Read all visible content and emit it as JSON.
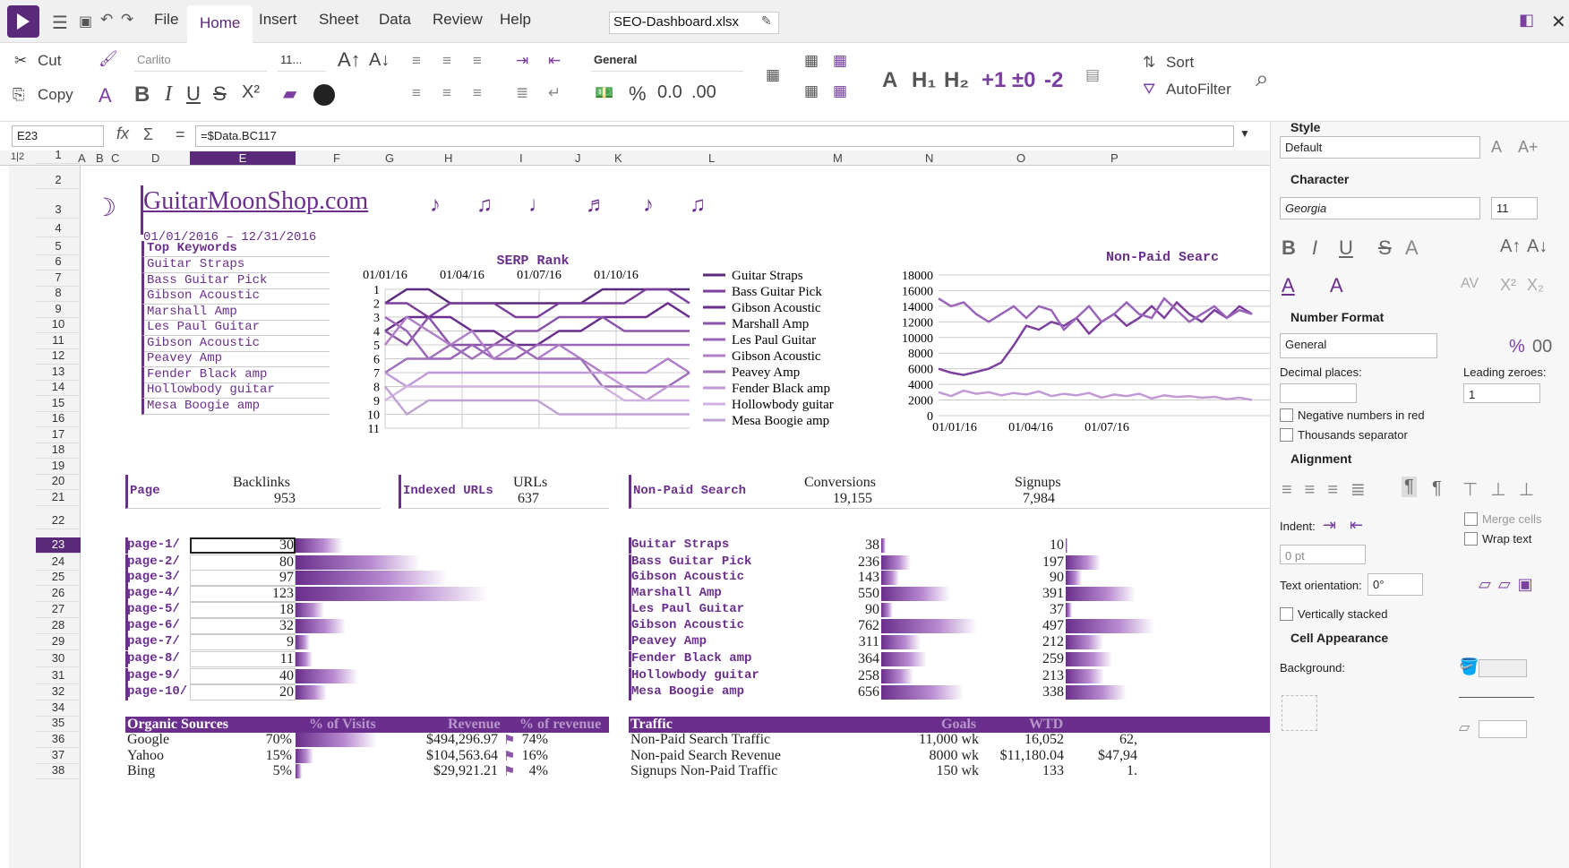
{
  "menubar": {
    "items": [
      "File",
      "Home",
      "Insert",
      "Sheet",
      "Data",
      "Review",
      "Help"
    ],
    "filename": "SEO-Dashboard.xlsx"
  },
  "toolbar": {
    "cut": "Cut",
    "copy": "Copy",
    "font": "Carlito",
    "size": "11...",
    "format": "General",
    "sort": "Sort",
    "autofilter": "AutoFilter",
    "pct": "%",
    "dec1": "0.0",
    "dec2": ".00",
    "plus1": "+1",
    "pm0": "±0",
    "minus2": "-2"
  },
  "formula": {
    "cell": "E23",
    "content": "=$Data.BC117"
  },
  "columns": [
    "A",
    "B",
    "C",
    "D",
    "E",
    "F",
    "G",
    "H",
    "I",
    "J",
    "K",
    "L",
    "M",
    "N",
    "O",
    "P"
  ],
  "rows": [
    "1",
    "2",
    "3",
    "4",
    "5",
    "6",
    "7",
    "8",
    "9",
    "10",
    "11",
    "12",
    "13",
    "14",
    "15",
    "16",
    "17",
    "18",
    "19",
    "20",
    "21",
    "22",
    "23",
    "24",
    "25",
    "26",
    "27",
    "28",
    "29",
    "30",
    "31",
    "32",
    "34",
    "35",
    "36",
    "37",
    "38"
  ],
  "dashboard": {
    "title": "GuitarMoonShop.com",
    "daterange": "01/01/2016 – 12/31/2016",
    "kw_header": "Top Keywords",
    "keywords": [
      "Guitar Straps",
      "Bass Guitar Pick",
      "Gibson Acoustic",
      "Marshall Amp",
      "Les Paul Guitar",
      "Gibson Acoustic",
      "Peavey Amp",
      "Fender Black amp",
      "Hollowbody guitar",
      "Mesa Boogie amp"
    ],
    "kpi": {
      "page": "Page",
      "backlinks_label": "Backlinks",
      "backlinks": "953",
      "indexed": "Indexed URLs",
      "urls_label": "URLs",
      "urls": "637",
      "nps": "Non-Paid Search",
      "conv_label": "Conversions",
      "conv": "19,155",
      "signups_label": "Signups",
      "signups": "7,984"
    },
    "pages": [
      {
        "p": "page-1/",
        "v": 30
      },
      {
        "p": "page-2/",
        "v": 80
      },
      {
        "p": "page-3/",
        "v": 97
      },
      {
        "p": "page-4/",
        "v": 123
      },
      {
        "p": "page-5/",
        "v": 18
      },
      {
        "p": "page-6/",
        "v": 32
      },
      {
        "p": "page-7/",
        "v": 9
      },
      {
        "p": "page-8/",
        "v": 11
      },
      {
        "p": "page-9/",
        "v": 40
      },
      {
        "p": "page-10/",
        "v": 20
      }
    ],
    "kwconv": [
      {
        "k": "Guitar Straps",
        "c": 38,
        "s": 10
      },
      {
        "k": "Bass Guitar Pick",
        "c": 236,
        "s": 197
      },
      {
        "k": "Gibson Acoustic",
        "c": 143,
        "s": 90
      },
      {
        "k": "Marshall Amp",
        "c": 550,
        "s": 391
      },
      {
        "k": "Les Paul Guitar",
        "c": 90,
        "s": 37
      },
      {
        "k": "Gibson Acoustic",
        "c": 762,
        "s": 497
      },
      {
        "k": "Peavey Amp",
        "c": 311,
        "s": 212
      },
      {
        "k": "Fender Black amp",
        "c": 364,
        "s": 259
      },
      {
        "k": "Hollowbody guitar",
        "c": 258,
        "s": 213
      },
      {
        "k": "Mesa Boogie amp",
        "c": 656,
        "s": 338
      }
    ],
    "organic": {
      "headers": [
        "Organic Sources",
        "% of Visits",
        "Revenue",
        "% of revenue"
      ],
      "rows": [
        [
          "Google",
          "70%",
          "$494,296.97",
          "74%"
        ],
        [
          "Yahoo",
          "15%",
          "$104,563.64",
          "16%"
        ],
        [
          "Bing",
          "5%",
          "$29,921.21",
          "4%"
        ]
      ]
    },
    "traffic": {
      "headers": [
        "Traffic",
        "Goals",
        "WTD"
      ],
      "rows": [
        [
          "Non-Paid Search Traffic",
          "11,000 wk",
          "16,052",
          "62,"
        ],
        [
          "Non-paid Search Revenue",
          "8000 wk",
          "$11,180.04",
          "$47,94"
        ],
        [
          "Signups Non-Paid Traffic",
          "150 wk",
          "133",
          "1."
        ]
      ]
    }
  },
  "chart_data": [
    {
      "type": "line",
      "title": "SERP Rank",
      "x": [
        "01/01/16",
        "01/04/16",
        "01/07/16",
        "01/10/16"
      ],
      "ylim": [
        11,
        1
      ],
      "series": [
        {
          "name": "Guitar Straps"
        },
        {
          "name": "Bass Guitar Pick"
        },
        {
          "name": "Gibson Acoustic"
        },
        {
          "name": "Marshall Amp"
        },
        {
          "name": "Les Paul Guitar"
        },
        {
          "name": "Gibson Acoustic"
        },
        {
          "name": "Peavey Amp"
        },
        {
          "name": "Fender Black amp"
        },
        {
          "name": "Hollowbody guitar"
        },
        {
          "name": "Mesa Boogie amp"
        }
      ]
    },
    {
      "type": "line",
      "title": "Non-Paid Searc",
      "x": [
        "01/01/16",
        "01/04/16",
        "01/07/16"
      ],
      "ylim": [
        0,
        18000
      ],
      "yticks": [
        "18000",
        "16000",
        "14000",
        "12000",
        "10000",
        "8000",
        "6000",
        "4000",
        "2000",
        "0"
      ]
    }
  ],
  "sidebar": {
    "style": "Style",
    "style_val": "Default",
    "character": "Character",
    "font": "Georgia",
    "size": "11",
    "numfmt": "Number Format",
    "numfmt_val": "General",
    "decimal": "Decimal places:",
    "leading": "Leading zeroes:",
    "leading_val": "1",
    "neg": "Negative numbers in red",
    "thousands": "Thousands separator",
    "alignment": "Alignment",
    "indent": "Indent:",
    "indent_val": "0 pt",
    "merge": "Merge cells",
    "wrap": "Wrap text",
    "orient": "Text orientation:",
    "orient_val": "0°",
    "vstack": "Vertically stacked",
    "cellapp": "Cell Appearance",
    "bg": "Background:"
  }
}
